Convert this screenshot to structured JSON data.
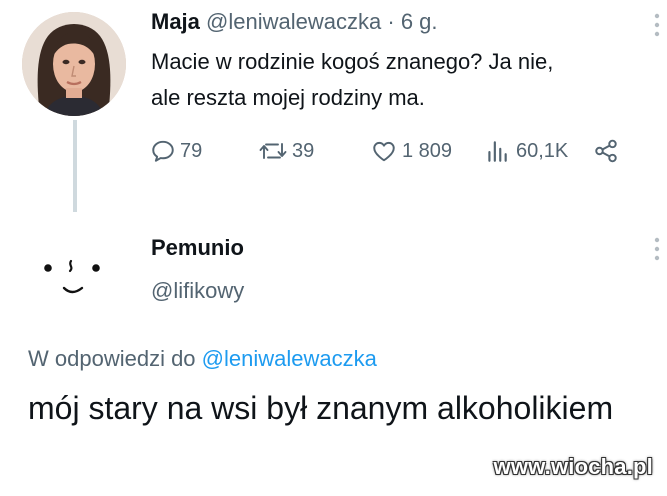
{
  "tweet": {
    "author_name": "Maja",
    "author_handle": "@leniwalewaczka",
    "separator": "·",
    "time": "6 g.",
    "text_line1": "Macie w rodzinie kogoś znanego? Ja nie,",
    "text_line2": "ale reszta mojej rodziny ma.",
    "stats": {
      "replies": "79",
      "retweets": "39",
      "likes": "1 809",
      "views": "60,1K"
    }
  },
  "reply": {
    "author_name": "Pemunio",
    "author_handle": "@lifikowy",
    "context_prefix": "W odpowiedzi do",
    "context_mention": "@leniwalewaczka",
    "text": "mój stary na wsi był znanym alkoholikiem"
  },
  "watermark": "www.wiocha.pl",
  "colors": {
    "text": "#0f1419",
    "secondary": "#536471",
    "mention": "#1d9bf0",
    "thread_line": "#cfd9de"
  },
  "icons": [
    "reply-icon",
    "retweet-icon",
    "like-icon",
    "views-icon",
    "share-icon",
    "more-icon"
  ]
}
